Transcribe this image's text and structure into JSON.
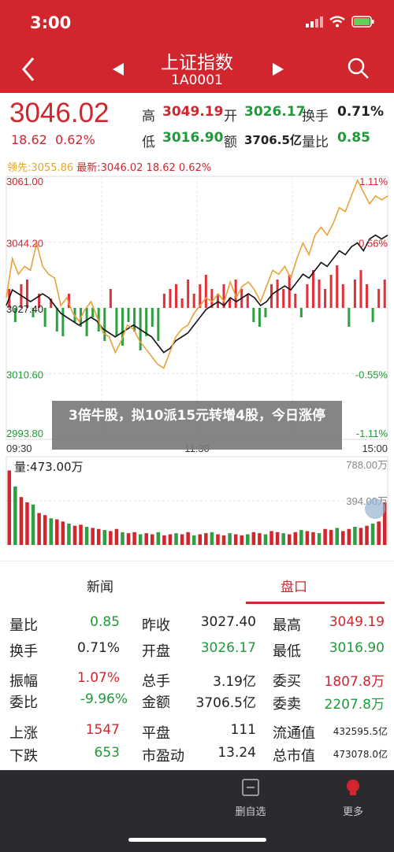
{
  "status": {
    "time": "3:00"
  },
  "nav": {
    "title": "上证指数",
    "code": "1A0001"
  },
  "quote": {
    "price": "3046.02",
    "change": "18.62",
    "change_pct": "0.62%",
    "high_label": "高",
    "high": "3049.19",
    "open_label": "开",
    "open": "3026.17",
    "turnover_label": "换手",
    "turnover": "0.71%",
    "low_label": "低",
    "low": "3016.90",
    "amount_label": "额",
    "amount": "3706.5亿",
    "volratio_label": "量比",
    "volratio": "0.85"
  },
  "chart_info": {
    "prev": "领先:3055.86",
    "latest": "最新:3046.02 18.62 0.62%"
  },
  "chart_data": {
    "type": "line",
    "y_ticks": [
      "3061.00",
      "3044.20",
      "3027.40",
      "3010.60",
      "2993.80"
    ],
    "y_ticks_right": [
      "1.11%",
      "0.56%",
      "",
      "-0.55%",
      "-1.11%"
    ],
    "x_ticks": [
      "09:30",
      "11:30",
      "15:00"
    ],
    "ylim": [
      2993.8,
      3061.0
    ],
    "series": [
      {
        "color": "#111111",
        "values": [
          3028,
          3032,
          3031,
          3030,
          3029,
          3030,
          3031,
          3030,
          3028,
          3026,
          3025,
          3024,
          3023,
          3024,
          3025,
          3024,
          3022,
          3021,
          3020,
          3021,
          3022,
          3023,
          3022,
          3021,
          3020,
          3018,
          3016,
          3017,
          3019,
          3020,
          3021,
          3023,
          3025,
          3027,
          3028,
          3029,
          3028,
          3030,
          3029,
          3030,
          3031,
          3030,
          3028,
          3029,
          3031,
          3032,
          3033,
          3032,
          3034,
          3036,
          3035,
          3037,
          3039,
          3038,
          3040,
          3042,
          3041,
          3043,
          3044,
          3042,
          3045,
          3046,
          3045,
          3046
        ]
      },
      {
        "color": "#e8a23a",
        "values": [
          3030,
          3040,
          3036,
          3038,
          3037,
          3044,
          3038,
          3036,
          3035,
          3028,
          3030,
          3026,
          3024,
          3027,
          3029,
          3025,
          3021,
          3020,
          3016,
          3019,
          3023,
          3022,
          3019,
          3017,
          3015,
          3013,
          3012,
          3016,
          3020,
          3022,
          3023,
          3026,
          3028,
          3030,
          3029,
          3031,
          3029,
          3034,
          3030,
          3033,
          3034,
          3032,
          3029,
          3033,
          3037,
          3036,
          3038,
          3035,
          3040,
          3044,
          3041,
          3046,
          3048,
          3046,
          3049,
          3053,
          3052,
          3056,
          3060,
          3057,
          3054,
          3056,
          3055,
          3056
        ]
      }
    ],
    "bars": [
      4,
      -3,
      5,
      6,
      -2,
      3,
      -4,
      2,
      -5,
      -6,
      3,
      -3,
      -4,
      -6,
      -2,
      -5,
      -7,
      4,
      -6,
      -8,
      -3,
      -5,
      -9,
      -6,
      -4,
      -7,
      3,
      4,
      5,
      2,
      6,
      3,
      5,
      7,
      4,
      3,
      5,
      2,
      6,
      4,
      3,
      -3,
      -4,
      -2,
      5,
      6,
      4,
      7,
      3,
      -2,
      5,
      8,
      6,
      4,
      7,
      9,
      5,
      -4,
      6,
      8,
      5,
      -3,
      4,
      6
    ],
    "volume_label": "量:473.00万",
    "volume_ticks": [
      "788.00万",
      "394.00万"
    ],
    "volume": [
      70,
      55,
      45,
      40,
      38,
      30,
      28,
      25,
      24,
      22,
      20,
      18,
      19,
      17,
      16,
      15,
      14,
      13,
      15,
      12,
      11,
      12,
      10,
      11,
      10,
      12,
      9,
      10,
      11,
      10,
      12,
      9,
      10,
      11,
      12,
      10,
      9,
      11,
      10,
      9,
      10,
      12,
      11,
      10,
      13,
      12,
      11,
      10,
      12,
      14,
      13,
      12,
      11,
      15,
      14,
      16,
      13,
      15,
      17,
      16,
      18,
      20,
      22,
      40
    ]
  },
  "overlay_text": "3倍牛股，拟10派15元转增4股，今日涨停",
  "tabs": {
    "news": "新闻",
    "handicap": "盘口"
  },
  "stats": {
    "r1": {
      "l1": "量比",
      "v1": "0.85",
      "l2": "昨收",
      "v2": "3027.40",
      "l3": "最高",
      "v3": "3049.19"
    },
    "r2": {
      "l1": "换手",
      "v1": "0.71%",
      "l2": "开盘",
      "v2": "3026.17",
      "l3": "最低",
      "v3": "3016.90"
    },
    "r3": {
      "l1": "振幅",
      "v1": "1.07%",
      "l2": "总手",
      "v2": "3.19亿",
      "l3": "委买",
      "v3": "1807.8万"
    },
    "r4": {
      "l1": "委比",
      "v1": "-9.96%",
      "l2": "金额",
      "v2": "3706.5亿",
      "l3": "委卖",
      "v3": "2207.8万"
    },
    "r5": {
      "l1": "上涨",
      "v1": "1547",
      "l2": "平盘",
      "v2": "111",
      "l3": "流通值",
      "v3": "432595.5亿"
    },
    "r6": {
      "l1": "下跌",
      "v1": "653",
      "l2": "市盈动",
      "v2": "13.24",
      "l3": "总市值",
      "v3": "473078.0亿"
    }
  },
  "bottom": {
    "watchlist": "删自选",
    "more": "更多"
  }
}
